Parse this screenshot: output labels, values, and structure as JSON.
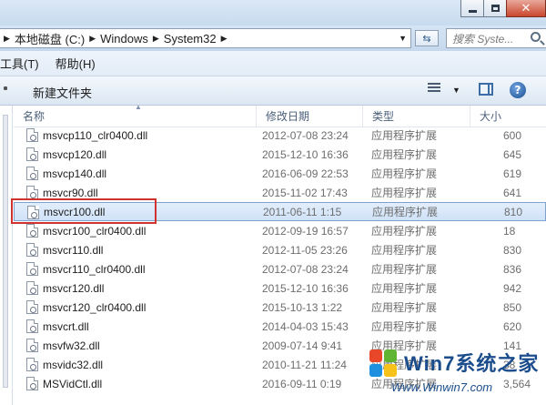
{
  "breadcrumb": [
    "本地磁盘 (C:)",
    "Windows",
    "System32"
  ],
  "search": {
    "placeholder": "搜索 Syste..."
  },
  "menu": [
    "工具(T)",
    "帮助(H)"
  ],
  "toolbar": {
    "new_folder": "新建文件夹"
  },
  "columns": {
    "name": "名称",
    "date": "修改日期",
    "type": "类型",
    "size": "大小"
  },
  "files": [
    {
      "name": "msvcp110_clr0400.dll",
      "date": "2012-07-08 23:24",
      "type": "应用程序扩展",
      "size": "600"
    },
    {
      "name": "msvcp120.dll",
      "date": "2015-12-10 16:36",
      "type": "应用程序扩展",
      "size": "645"
    },
    {
      "name": "msvcp140.dll",
      "date": "2016-06-09 22:53",
      "type": "应用程序扩展",
      "size": "619"
    },
    {
      "name": "msvcr90.dll",
      "date": "2015-11-02 17:43",
      "type": "应用程序扩展",
      "size": "641"
    },
    {
      "name": "msvcr100.dll",
      "date": "2011-06-11 1:15",
      "type": "应用程序扩展",
      "size": "810",
      "selected": true
    },
    {
      "name": "msvcr100_clr0400.dll",
      "date": "2012-09-19 16:57",
      "type": "应用程序扩展",
      "size": "18"
    },
    {
      "name": "msvcr110.dll",
      "date": "2012-11-05 23:26",
      "type": "应用程序扩展",
      "size": "830"
    },
    {
      "name": "msvcr110_clr0400.dll",
      "date": "2012-07-08 23:24",
      "type": "应用程序扩展",
      "size": "836"
    },
    {
      "name": "msvcr120.dll",
      "date": "2015-12-10 16:36",
      "type": "应用程序扩展",
      "size": "942"
    },
    {
      "name": "msvcr120_clr0400.dll",
      "date": "2015-10-13 1:22",
      "type": "应用程序扩展",
      "size": "850"
    },
    {
      "name": "msvcrt.dll",
      "date": "2014-04-03 15:43",
      "type": "应用程序扩展",
      "size": "620"
    },
    {
      "name": "msvfw32.dll",
      "date": "2009-07-14 9:41",
      "type": "应用程序扩展",
      "size": "141"
    },
    {
      "name": "msvidc32.dll",
      "date": "2010-11-21 11:24",
      "type": "应用程序扩展",
      "size": "38"
    },
    {
      "name": "MSVidCtl.dll",
      "date": "2016-09-11 0:19",
      "type": "应用程序扩展",
      "size": "3,564"
    }
  ],
  "watermark": {
    "brand": "Win7系统之家",
    "url": "Www.Winwin7.com"
  }
}
